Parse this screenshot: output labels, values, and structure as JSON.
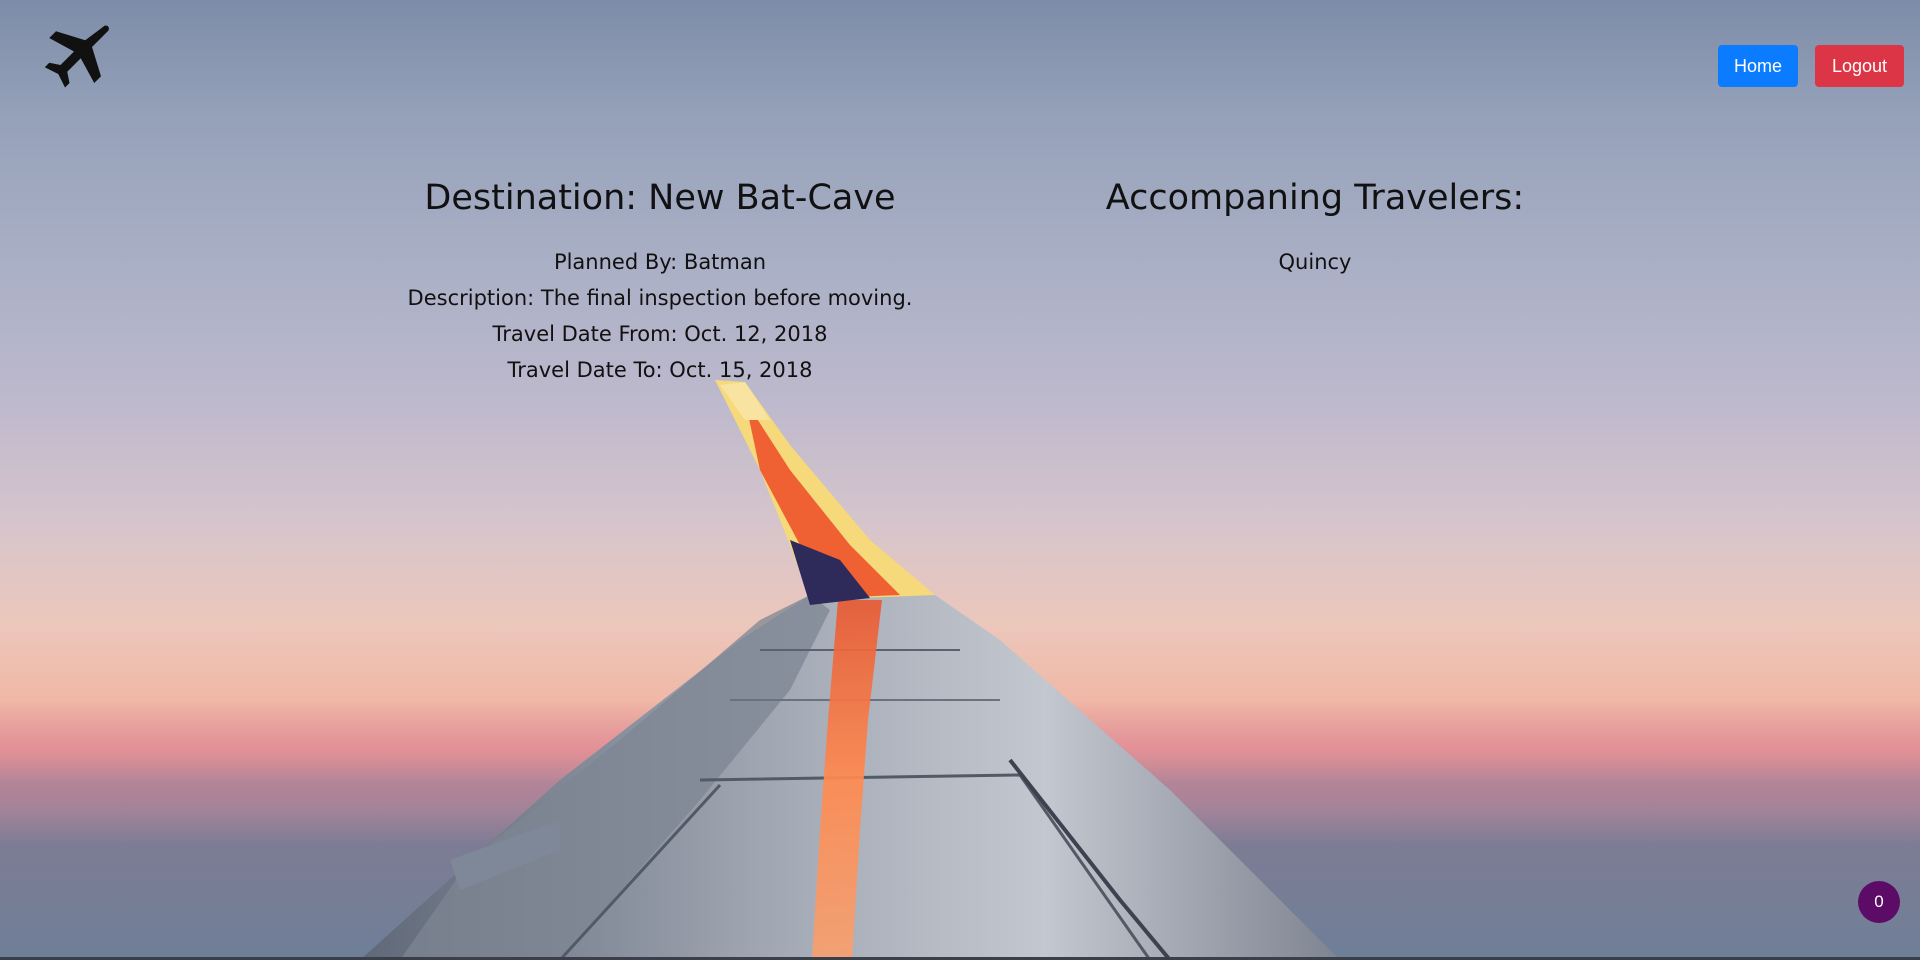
{
  "header": {
    "logo_icon": "airplane-icon",
    "home_label": "Home",
    "logout_label": "Logout"
  },
  "trip": {
    "destination_title": "Destination: New Bat-Cave",
    "planned_by": "Planned By: Batman",
    "description": "Description: The final inspection before moving.",
    "date_from": "Travel Date From: Oct. 12, 2018",
    "date_to": "Travel Date To: Oct. 15, 2018"
  },
  "travelers": {
    "title": "Accompaning Travelers:",
    "list": [
      "Quincy"
    ]
  },
  "badge": {
    "count": "0"
  },
  "colors": {
    "home_button": "#0b7bff",
    "logout_button": "#dc3545",
    "badge": "#5c0c66"
  }
}
